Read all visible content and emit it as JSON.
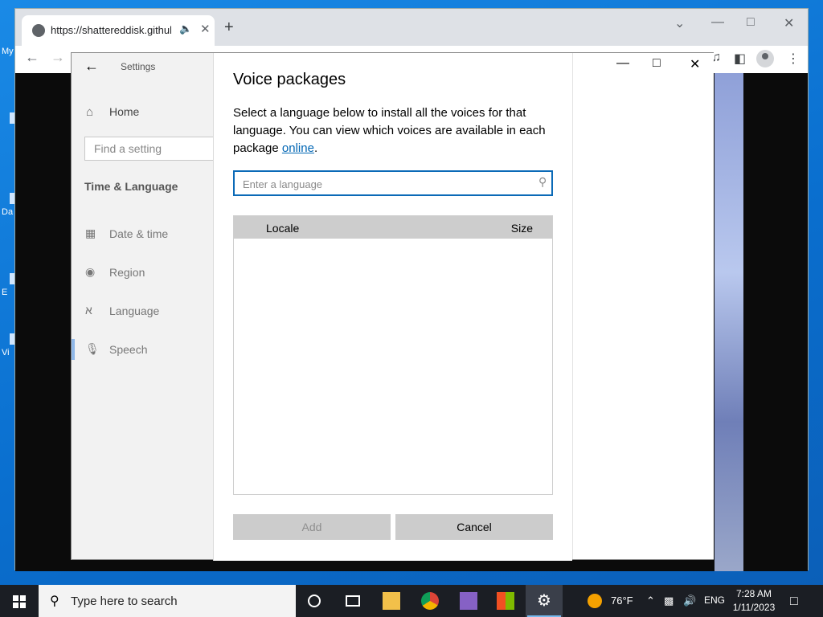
{
  "browser": {
    "tab_url": "https://shattereddisk.github.io",
    "tab_icon": "globe-icon",
    "new_tab": "+"
  },
  "settings": {
    "title": "Settings",
    "home": "Home",
    "search_placeholder": "Find a setting",
    "section": "Time & Language",
    "nav": [
      {
        "label": "Date & time",
        "icon": "calendar-clock-icon"
      },
      {
        "label": "Region",
        "icon": "globe-icon"
      },
      {
        "label": "Language",
        "icon": "language-icon"
      },
      {
        "label": "Speech",
        "icon": "microphone-icon"
      }
    ],
    "active_nav": "Speech"
  },
  "dialog": {
    "title": "Voice packages",
    "description": "Select a language below to install all the voices for that language. You can view which voices are available in each package ",
    "link": "online",
    "description_end": ".",
    "input_placeholder": "Enter a language",
    "input_value": "",
    "columns": {
      "locale": "Locale",
      "size": "Size"
    },
    "rows": [],
    "add_label": "Add",
    "cancel_label": "Cancel"
  },
  "taskbar": {
    "search_text": "Type here to search",
    "weather": "76°F",
    "language": "ENG",
    "time": "7:28 AM",
    "date": "1/11/2023"
  }
}
